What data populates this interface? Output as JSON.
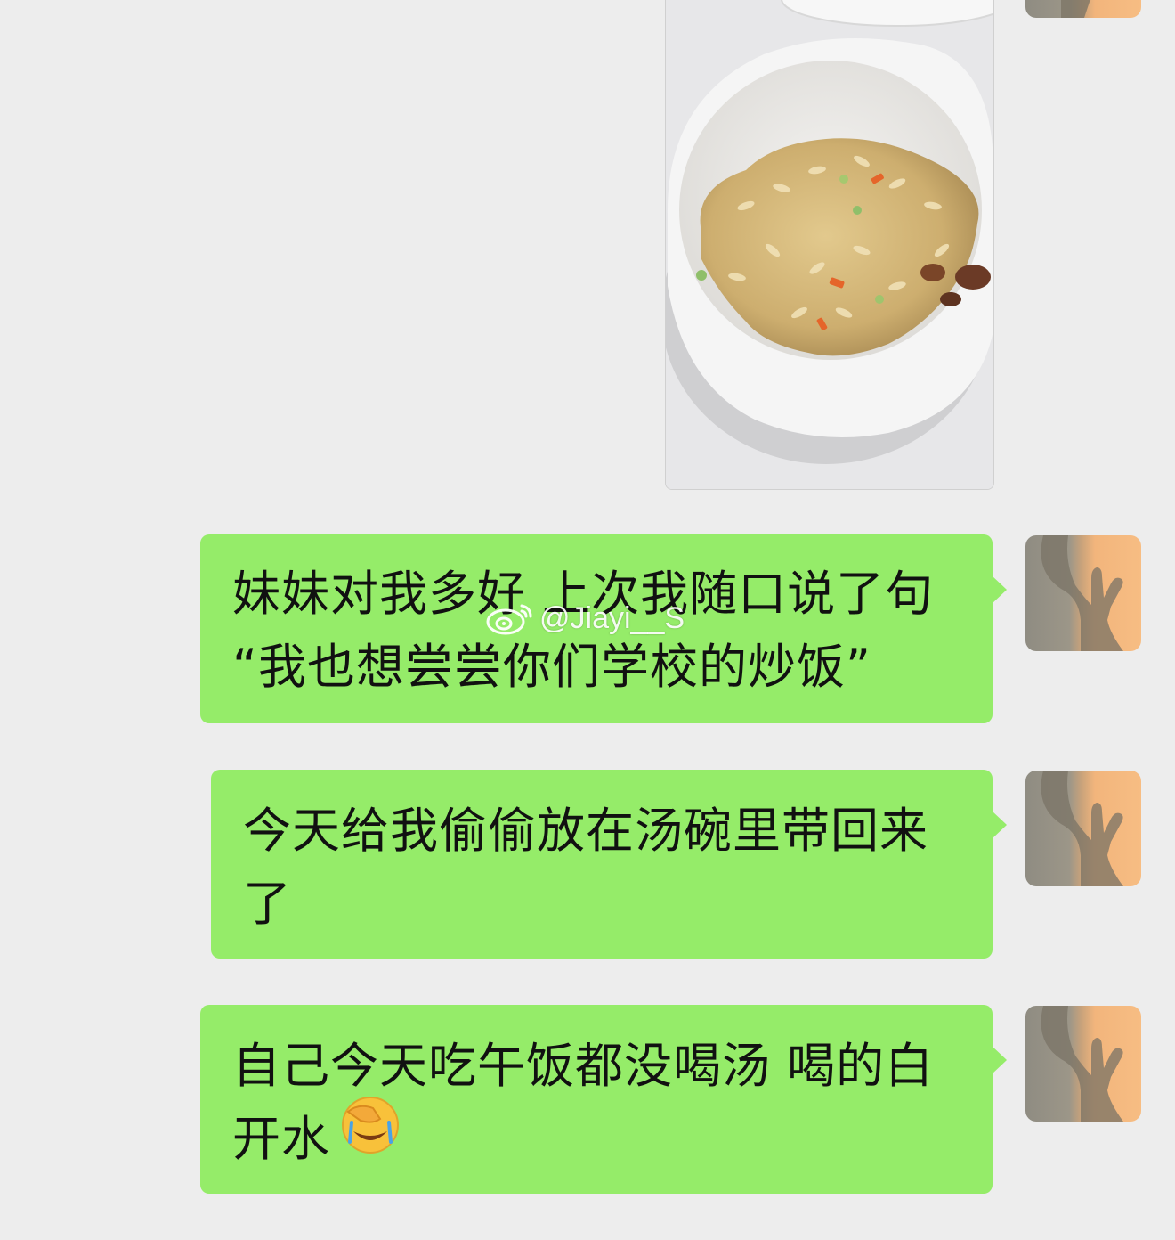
{
  "messages": [
    {
      "id": 1,
      "type": "image",
      "sender": "self",
      "icon": "fried-rice-photo"
    },
    {
      "id": 2,
      "type": "text",
      "sender": "self",
      "text": "妹妹对我多好 上次我随口说了句\n“我也想尝尝你们学校的炒饭”"
    },
    {
      "id": 3,
      "type": "text",
      "sender": "self",
      "text": "今天给我偷偷放在汤碗里带回来\n了"
    },
    {
      "id": 4,
      "type": "text",
      "sender": "self",
      "text": "自己今天吃午饭都没喝汤 喝的白\n开水",
      "emoji": "face-palm-laughing-emoji"
    }
  ],
  "watermark": {
    "text": "@Jiayi__S",
    "icon": "weibo-logo-icon"
  },
  "colors": {
    "background": "#ededed",
    "bubble": "#95ec69",
    "text": "#111111"
  }
}
